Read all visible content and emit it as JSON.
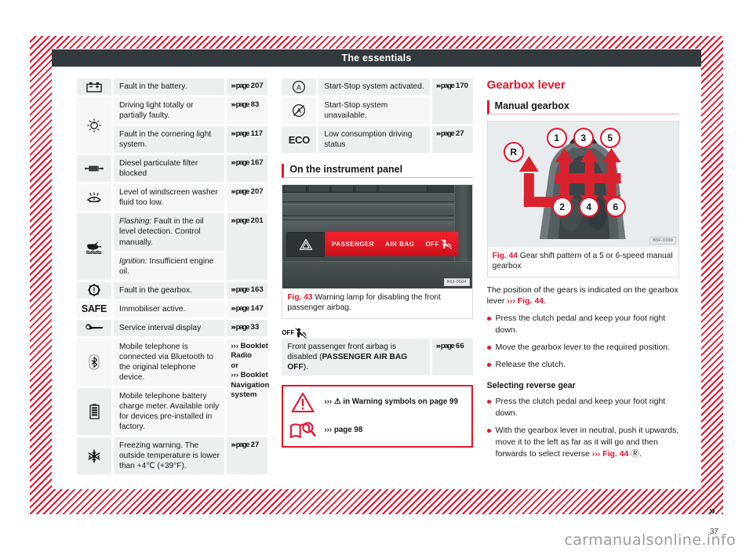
{
  "header": {
    "title": "The essentials"
  },
  "page_number": "37",
  "continuation_arrow": "»",
  "watermark": "carmanualsonline.info",
  "colors": {
    "brand_red": "#e8132b",
    "header_bar": "#333a3d",
    "cell_bg": "#eceff0",
    "cell_bg_alt": "#f5f6f7"
  },
  "left_column": {
    "symbol_rows": [
      {
        "icon": "battery-icon",
        "entries": [
          {
            "text": "Fault in the battery.",
            "ref_prefix": "››› page",
            "ref_value": "207"
          }
        ]
      },
      {
        "icon": "headlight-icon",
        "entries": [
          {
            "text": "Driving light totally or partially faulty.",
            "ref_prefix": "››› page",
            "ref_value": "83"
          },
          {
            "text": "Fault in the cornering light system.",
            "ref_prefix": "››› page",
            "ref_value": "117"
          }
        ]
      },
      {
        "icon": "diesel-particulate-filter-icon",
        "entries": [
          {
            "text": "Diesel particulate filter blocked",
            "ref_prefix": "››› page",
            "ref_value": "167"
          }
        ]
      },
      {
        "icon": "windscreen-washer-icon",
        "entries": [
          {
            "text": "Level of windscreen washer fluid too low.",
            "ref_prefix": "››› page",
            "ref_value": "207"
          }
        ]
      },
      {
        "icon": "oil-level-icon",
        "shared_ref": {
          "ref_prefix": "››› page",
          "ref_value": "201"
        },
        "entries": [
          {
            "italic_lead": "Flashing:",
            "text": " Fault in the oil level detection. Control manually."
          },
          {
            "italic_lead": "Ignition:",
            "text": " Insufficient engine oil."
          }
        ]
      },
      {
        "icon": "gearbox-fault-icon",
        "entries": [
          {
            "text": "Fault in the gearbox.",
            "ref_prefix": "››› page",
            "ref_value": "163"
          }
        ]
      },
      {
        "icon": "safe-immobiliser-icon",
        "icon_text": "SAFE",
        "entries": [
          {
            "text": "Immobiliser active.",
            "ref_prefix": "››› page",
            "ref_value": "147"
          }
        ]
      },
      {
        "icon": "spanner-service-icon",
        "entries": [
          {
            "text": "Service interval display",
            "ref_prefix": "››› page",
            "ref_value": "33"
          }
        ]
      },
      {
        "icon": "bluetooth-icon",
        "shared_ref_multiline": [
          "››› Booklet Radio",
          "or",
          "››› Booklet Navigation system"
        ],
        "entries": [
          {
            "text": "Mobile telephone is connected via Bluetooth to the original telephone device."
          }
        ]
      },
      {
        "icon": "phone-battery-icon",
        "entries": [
          {
            "text": "Mobile telephone battery charge meter. Available only for devices pre-installed in factory."
          }
        ]
      },
      {
        "icon": "frost-snowflake-icon",
        "entries": [
          {
            "text": "Freezing warning. The outside temperature is lower than +4℃ (+39°F).",
            "ref_prefix": "››› page",
            "ref_value": "27"
          }
        ]
      }
    ]
  },
  "middle_column": {
    "symbol_rows": [
      {
        "icon": "start-stop-active-icon",
        "text": "Start-Stop system activated.",
        "ref_prefix": "››› page",
        "ref_value": "170",
        "ref_span": 2
      },
      {
        "icon": "start-stop-unavailable-icon",
        "text": "Start-Stop system unavailable."
      },
      {
        "icon": "eco-icon",
        "icon_text": "ECO",
        "text": "Low consumption driving status",
        "ref_prefix": "››› page",
        "ref_value": "27"
      }
    ],
    "section_heading": "On the instrument panel",
    "figure": {
      "code": "B6J-0504",
      "caption_label": "Fig. 43",
      "caption_text": "Warning lamp for disabling the front passenger airbag.",
      "lamp_text_1": "PASSENGER",
      "lamp_text_2": "AIR BAG",
      "lamp_text_3": "OFF"
    },
    "airbag_row": {
      "icon": "passenger-airbag-off-icon",
      "icon_text": "OFF",
      "text_before": "Front passenger front airbag is disabled (",
      "text_bold": "PASSENGER AIR BAG OFF",
      "text_after": ").",
      "ref_prefix": "››› page",
      "ref_value": "66"
    },
    "note_box": {
      "rows": [
        {
          "icon": "warning-triangle-icon",
          "text": "››› ⚠ in Warning symbols on page 99"
        },
        {
          "icon": "book-magnifier-icon",
          "text": "››› page 98"
        }
      ]
    }
  },
  "right_column": {
    "title": "Gearbox lever",
    "section_heading": "Manual gearbox",
    "figure": {
      "code": "B5F-0399",
      "caption_label": "Fig. 44",
      "caption_text": "Gear shift pattern of a 5 or 6-speed manual gearbox",
      "gear_labels": [
        "R",
        "1",
        "3",
        "5",
        "2",
        "4",
        "6"
      ]
    },
    "intro_text_a": "The position of the gears is indicated on the gearbox lever ",
    "intro_ref": "››› Fig. 44",
    "intro_text_b": ".",
    "bullets": [
      "Press the clutch pedal and keep your foot right down.",
      "Move the gearbox lever to the required position.",
      "Release the clutch."
    ],
    "subheading": "Selecting reverse gear",
    "bullets2_1": "Press the clutch pedal and keep your foot right down.",
    "bullets2_2_a": "With the gearbox lever in neutral, push it upwards, move it to the left as far as it will go and then forwards to select reverse ",
    "bullets2_2_ref": "››› Fig. 44",
    "bullets2_2_b": " Ⓡ."
  }
}
